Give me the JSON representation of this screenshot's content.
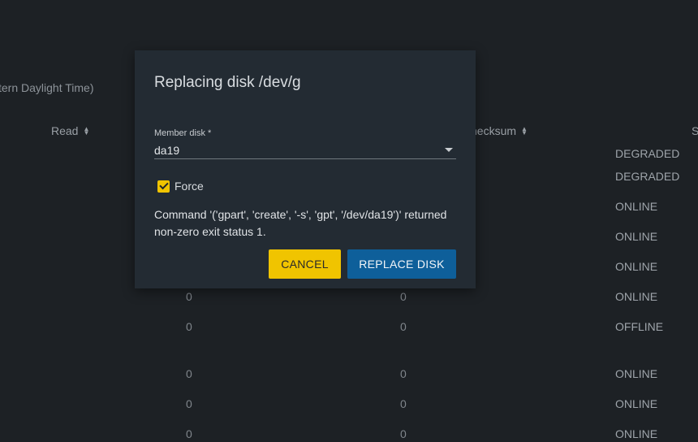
{
  "background": {
    "timezone_fragment": "tern Daylight Time)",
    "columns": {
      "read": "Read",
      "checksum": "hecksum",
      "status_fragment": "S"
    },
    "statuses_top": [
      "DEGRADED",
      "DEGRADED",
      "ONLINE",
      "ONLINE",
      "ONLINE"
    ],
    "rows": [
      {
        "read": "0",
        "checksum": "0",
        "status": "ONLINE"
      },
      {
        "read": "0",
        "checksum": "0",
        "status": "OFFLINE"
      },
      {
        "read": "0",
        "checksum": "0",
        "status": "ONLINE"
      },
      {
        "read": "0",
        "checksum": "0",
        "status": "ONLINE"
      },
      {
        "read": "0",
        "checksum": "0",
        "status": "ONLINE"
      }
    ]
  },
  "dialog": {
    "title": "Replacing disk /dev/g",
    "member_disk": {
      "label": "Member disk *",
      "value": "da19"
    },
    "force": {
      "label": "Force",
      "checked": true
    },
    "error": "Command '('gpart', 'create', '-s', 'gpt', '/dev/da19')' returned non-zero exit status 1.",
    "cancel_label": "CANCEL",
    "replace_label": "REPLACE DISK"
  },
  "colors": {
    "accent_yellow": "#f0c400",
    "primary_blue": "#0e5f9a",
    "dialog_bg": "#232b33",
    "page_bg": "#1d2125"
  }
}
